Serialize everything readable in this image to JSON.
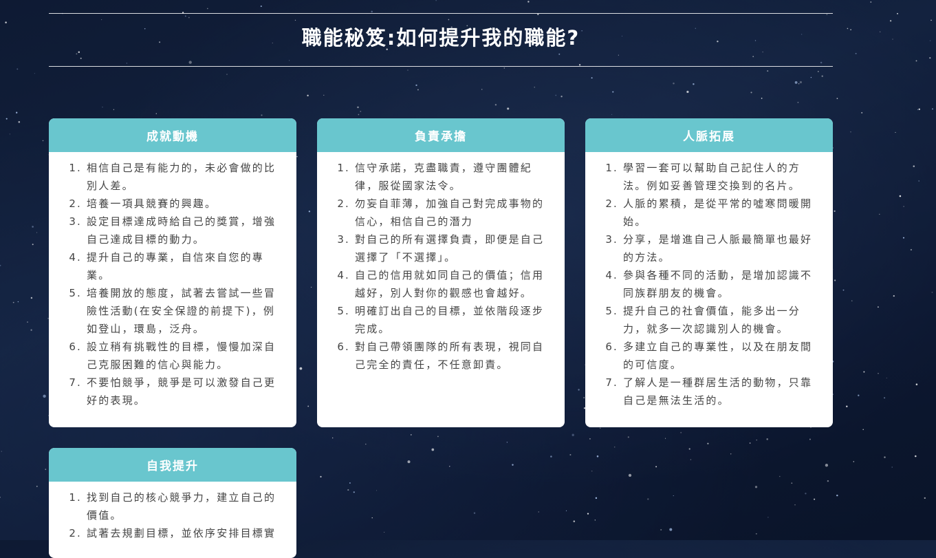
{
  "page": {
    "title": "職能秘笈:如何提升我的職能?"
  },
  "colors": {
    "header_accent": "#69c6ce",
    "background": "#13223f",
    "card_text": "#444444"
  },
  "cards": [
    {
      "title": "成就動機",
      "items": [
        "相信自己是有能力的，未必會做的比別人差。",
        "培養一項具競賽的興趣。",
        "設定目標達成時給自己的獎賞，增強自己達成目標的動力。",
        "提升自己的專業，自信來自您的專業。",
        "培養開放的態度，試著去嘗試一些冒險性活動(在安全保證的前提下)，例如登山，環島，泛舟。",
        "設立稍有挑戰性的目標，慢慢加深自己克服困難的信心與能力。",
        "不要怕競爭，競爭是可以激發自己更好的表現。"
      ]
    },
    {
      "title": "負責承擔",
      "items": [
        "信守承諾，克盡職責，遵守團體紀律，服從國家法令。",
        "勿妄自菲薄，加強自己對完成事物的信心，相信自己的潛力",
        "對自己的所有選擇負責，即便是自己選擇了「不選擇」。",
        "自己的信用就如同自己的價值；信用越好，別人對你的觀感也會越好。",
        "明確訂出自己的目標，並依階段逐步完成。",
        "對自己帶領團隊的所有表現，視同自己完全的責任，不任意卸責。"
      ]
    },
    {
      "title": "人脈拓展",
      "items": [
        "學習一套可以幫助自己記住人的方法。例如妥善管理交換到的名片。",
        "人脈的累積，是從平常的噓寒問暖開始。",
        "分享，是增進自己人脈最簡單也最好的方法。",
        "參與各種不同的活動，是增加認識不同族群朋友的機會。",
        "提升自己的社會價值，能多出一分力，就多一次認識別人的機會。",
        "多建立自己的專業性，以及在朋友間的可信度。",
        "了解人是一種群居生活的動物，只靠自己是無法生活的。"
      ]
    },
    {
      "title": "自我提升",
      "items": [
        "找到自己的核心競爭力，建立自己的價值。",
        "試著去規劃目標，並依序安排目標實"
      ]
    }
  ]
}
